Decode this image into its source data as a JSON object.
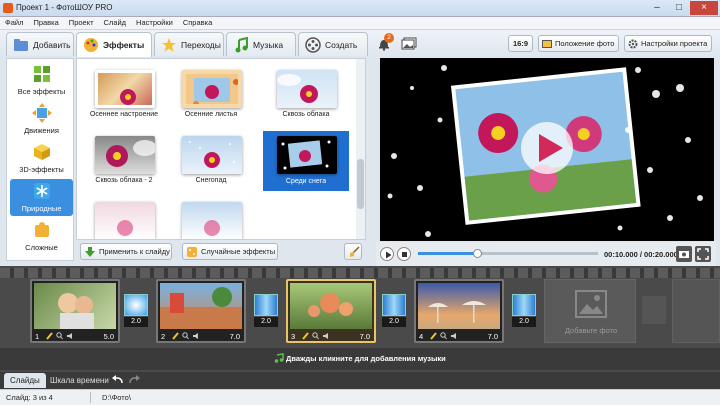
{
  "window": {
    "title": "Проект 1 - ФотоШОУ PRO"
  },
  "menu": [
    "Файл",
    "Правка",
    "Проект",
    "Слайд",
    "Настройки",
    "Справка"
  ],
  "tabs": [
    {
      "label": "Добавить"
    },
    {
      "label": "Эффекты"
    },
    {
      "label": "Переходы"
    },
    {
      "label": "Музыка"
    },
    {
      "label": "Создать"
    }
  ],
  "notifications": {
    "count": "2"
  },
  "toolbar_right": {
    "aspect": "16:9",
    "photo_position": "Положение фото",
    "project_settings": "Настройки проекта"
  },
  "categories": [
    {
      "label": "Все эффекты"
    },
    {
      "label": "Движения"
    },
    {
      "label": "3D-эффекты"
    },
    {
      "label": "Природные"
    },
    {
      "label": "Сложные"
    }
  ],
  "effects": [
    {
      "label": "Осеннее настроение"
    },
    {
      "label": "Осенние листья"
    },
    {
      "label": "Сквозь облака"
    },
    {
      "label": "Сквозь облака - 2"
    },
    {
      "label": "Снегопад"
    },
    {
      "label": "Среди снега"
    },
    {
      "label": ""
    },
    {
      "label": ""
    }
  ],
  "actions": {
    "apply": "Применить к слайду",
    "random": "Случайные эффекты"
  },
  "player": {
    "time": "00:10.000 / 00:20.000",
    "progress": 0.33
  },
  "slides": [
    {
      "num": "1",
      "dur": "5.0"
    },
    {
      "num": "2",
      "dur": "7.0"
    },
    {
      "num": "3",
      "dur": "7.0"
    },
    {
      "num": "4",
      "dur": "7.0"
    }
  ],
  "transitions": [
    {
      "dur": "2.0"
    },
    {
      "dur": "2.0"
    },
    {
      "dur": "2.0"
    },
    {
      "dur": "2.0"
    }
  ],
  "add_photo": "Добавьте фото",
  "music_hint": "Дважды кликните для добавления музыки",
  "bottom_tabs": {
    "slides": "Слайды",
    "timeline": "Шкала времени"
  },
  "status": {
    "slide_info": "Слайд: 3 из 4",
    "path": "D:\\Фото\\"
  }
}
